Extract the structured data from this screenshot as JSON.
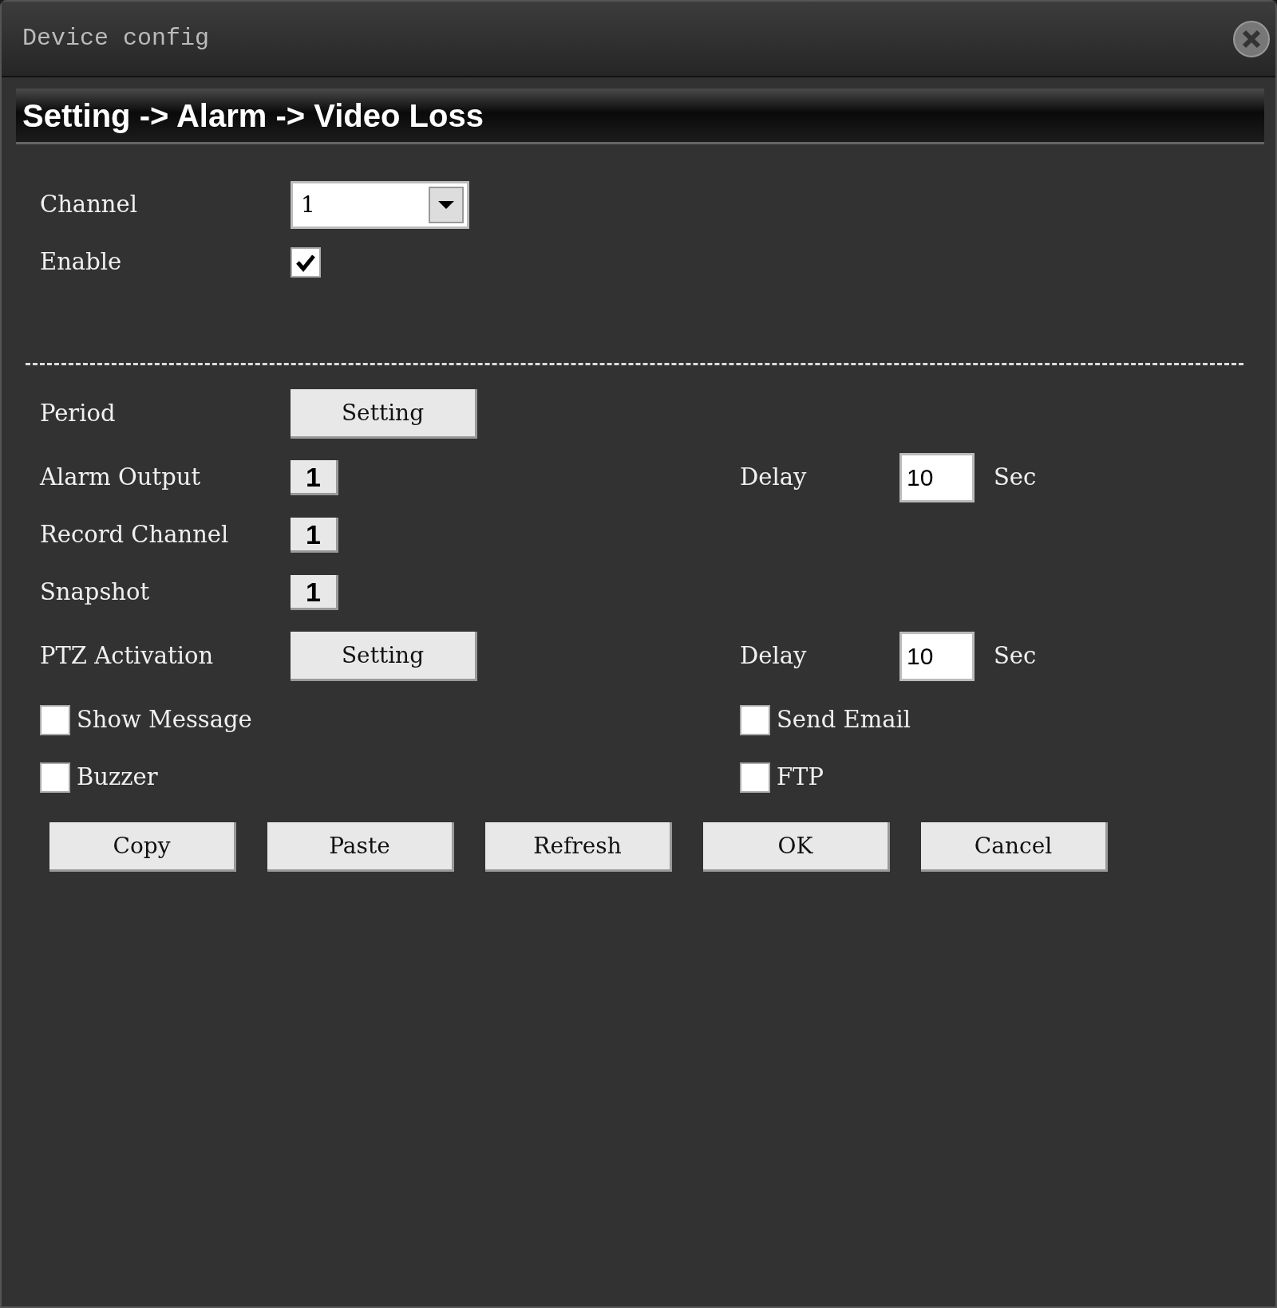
{
  "window": {
    "title": "Device config"
  },
  "breadcrumb": "Setting -> Alarm -> Video Loss",
  "channel": {
    "label": "Channel",
    "value": "1"
  },
  "enable": {
    "label": "Enable",
    "checked": true
  },
  "rows": [
    {
      "kind": "button",
      "label": "Period",
      "button": "Setting"
    },
    {
      "kind": "picker",
      "label": "Alarm Output",
      "value": "1",
      "delay": {
        "label": "Delay",
        "value": "10",
        "unit": "Sec"
      }
    },
    {
      "kind": "picker",
      "label": "Record Channel",
      "value": "1"
    },
    {
      "kind": "picker",
      "label": "Snapshot",
      "value": "1"
    },
    {
      "kind": "button",
      "label": "PTZ Activation",
      "button": "Setting",
      "delay": {
        "label": "Delay",
        "value": "10",
        "unit": "Sec"
      }
    }
  ],
  "checks": [
    [
      {
        "label": "Show Message",
        "checked": false
      },
      {
        "label": "Send Email",
        "checked": false
      }
    ],
    [
      {
        "label": "Buzzer",
        "checked": false
      },
      {
        "label": "FTP",
        "checked": false
      }
    ]
  ],
  "buttons": [
    "Copy",
    "Paste",
    "Refresh",
    "OK",
    "Cancel"
  ]
}
